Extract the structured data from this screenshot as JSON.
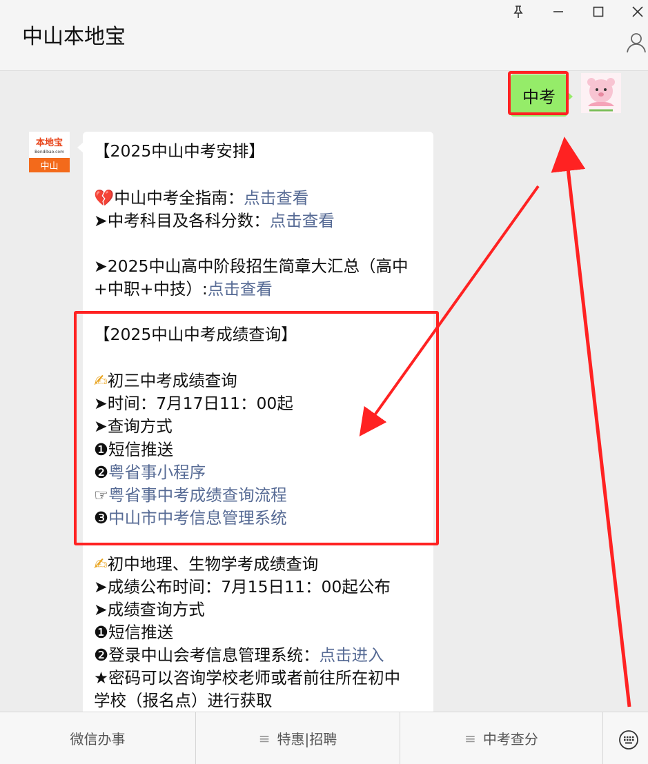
{
  "window": {
    "title": "中山本地宝",
    "controls": [
      "pin",
      "minimize",
      "maximize",
      "close"
    ]
  },
  "chat": {
    "my_message": "中考",
    "bot_avatar": {
      "top": "本地宝",
      "sub": "Bendibao.com",
      "bottom": "中山"
    },
    "lines": [
      {
        "text": "【2025中山中考安排】"
      },
      {
        "prefix": "💔",
        "text": "中山中考全指南：",
        "link": "点击查看"
      },
      {
        "prefix": "➤",
        "text": "中考科目及各科分数：",
        "link": "点击查看"
      },
      {
        "prefix": "➤",
        "text": "2025中山高中阶段招生简章大汇总（高中"
      },
      {
        "text": "+中职+中技）:",
        "link": "点击查看"
      },
      {
        "text": "【2025中山中考成绩查询】"
      },
      {
        "prefix": "✍",
        "text": "初三中考成绩查询"
      },
      {
        "prefix": "➤",
        "text": "时间：7月17日11：00起"
      },
      {
        "prefix": "➤",
        "text": "查询方式"
      },
      {
        "prefix": "❶",
        "text": "短信推送"
      },
      {
        "prefix": "❷",
        "text": "",
        "link": "粤省事小程序"
      },
      {
        "prefix": "☞",
        "text": "",
        "link": "粤省事中考成绩查询流程"
      },
      {
        "prefix": "❸",
        "text": "",
        "link": "中山市中考信息管理系统"
      },
      {
        "prefix": "✍",
        "text": "初中地理、生物学考成绩查询"
      },
      {
        "prefix": "➤",
        "text": "成绩公布时间：7月15日11：00起公布"
      },
      {
        "prefix": "➤",
        "text": "成绩查询方式"
      },
      {
        "prefix": "❶",
        "text": "短信推送"
      },
      {
        "prefix": "❷",
        "text": "登录中山会考信息管理系统：",
        "link": "点击进入"
      },
      {
        "prefix": "★",
        "text": "密码可以咨询学校老师或者前往所在初中"
      },
      {
        "text": "学校（报名点）进行获取"
      }
    ]
  },
  "bottom_menu": {
    "items": [
      {
        "label": "微信办事",
        "icon": ""
      },
      {
        "label": "特惠|招聘",
        "icon": "≡"
      },
      {
        "label": "中考查分",
        "icon": "≡"
      }
    ],
    "keyboard_icon": "keyboard-icon"
  },
  "colors": {
    "link": "#576b95",
    "highlight": "#ff2222",
    "my_bubble": "#95ec69"
  }
}
